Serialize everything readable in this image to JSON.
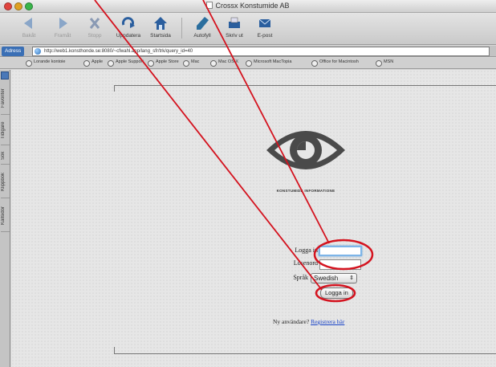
{
  "window": {
    "title": "Crossx Konstumide AB"
  },
  "toolbar": {
    "buttons": [
      {
        "label": "Bakåt",
        "icon": "back-arrow-icon",
        "enabled": false
      },
      {
        "label": "Framåt",
        "icon": "forward-arrow-icon",
        "enabled": false
      },
      {
        "label": "Stopp",
        "icon": "stop-x-icon",
        "enabled": false
      },
      {
        "label": "Uppdatera",
        "icon": "refresh-icon",
        "enabled": true
      },
      {
        "label": "Startsida",
        "icon": "home-icon",
        "enabled": true
      },
      {
        "label": "Autofyll",
        "icon": "autofill-pen-icon",
        "enabled": true
      },
      {
        "label": "Skriv ut",
        "icon": "printer-icon",
        "enabled": true
      },
      {
        "label": "E-post",
        "icon": "mail-icon",
        "enabled": true
      }
    ]
  },
  "address": {
    "label": "Adress",
    "url": "http://web1.konsthonde.se:8080/~cfwahl.app/lang_sfr/trk/query_id=40"
  },
  "favorites": [
    "Lorande kontoie",
    "Apple",
    "Apple Support",
    "Apple Store",
    "Mac",
    "Mac OS X",
    "Microsoft MacTopia",
    "Office for Macintosh",
    "MSN"
  ],
  "sidebar": {
    "tabs": [
      "Favoriter",
      "Tidigare",
      "Sök",
      "Klippbok",
      "Källsidor"
    ]
  },
  "page": {
    "logo_text": "KONSTUMIDE INFORMATIONE",
    "username_label": "Logga in",
    "password_label": "Lösenord",
    "language_label": "Språk",
    "language_value": "Swedish",
    "login_button": "Logga in",
    "new_user_text": "Ny användare?",
    "register_link": "Registrera här"
  },
  "colors": {
    "annotation": "#d4131f",
    "focus_ring": "#7db5e8",
    "link": "#1a44c8",
    "logo": "#4a4a4a"
  }
}
